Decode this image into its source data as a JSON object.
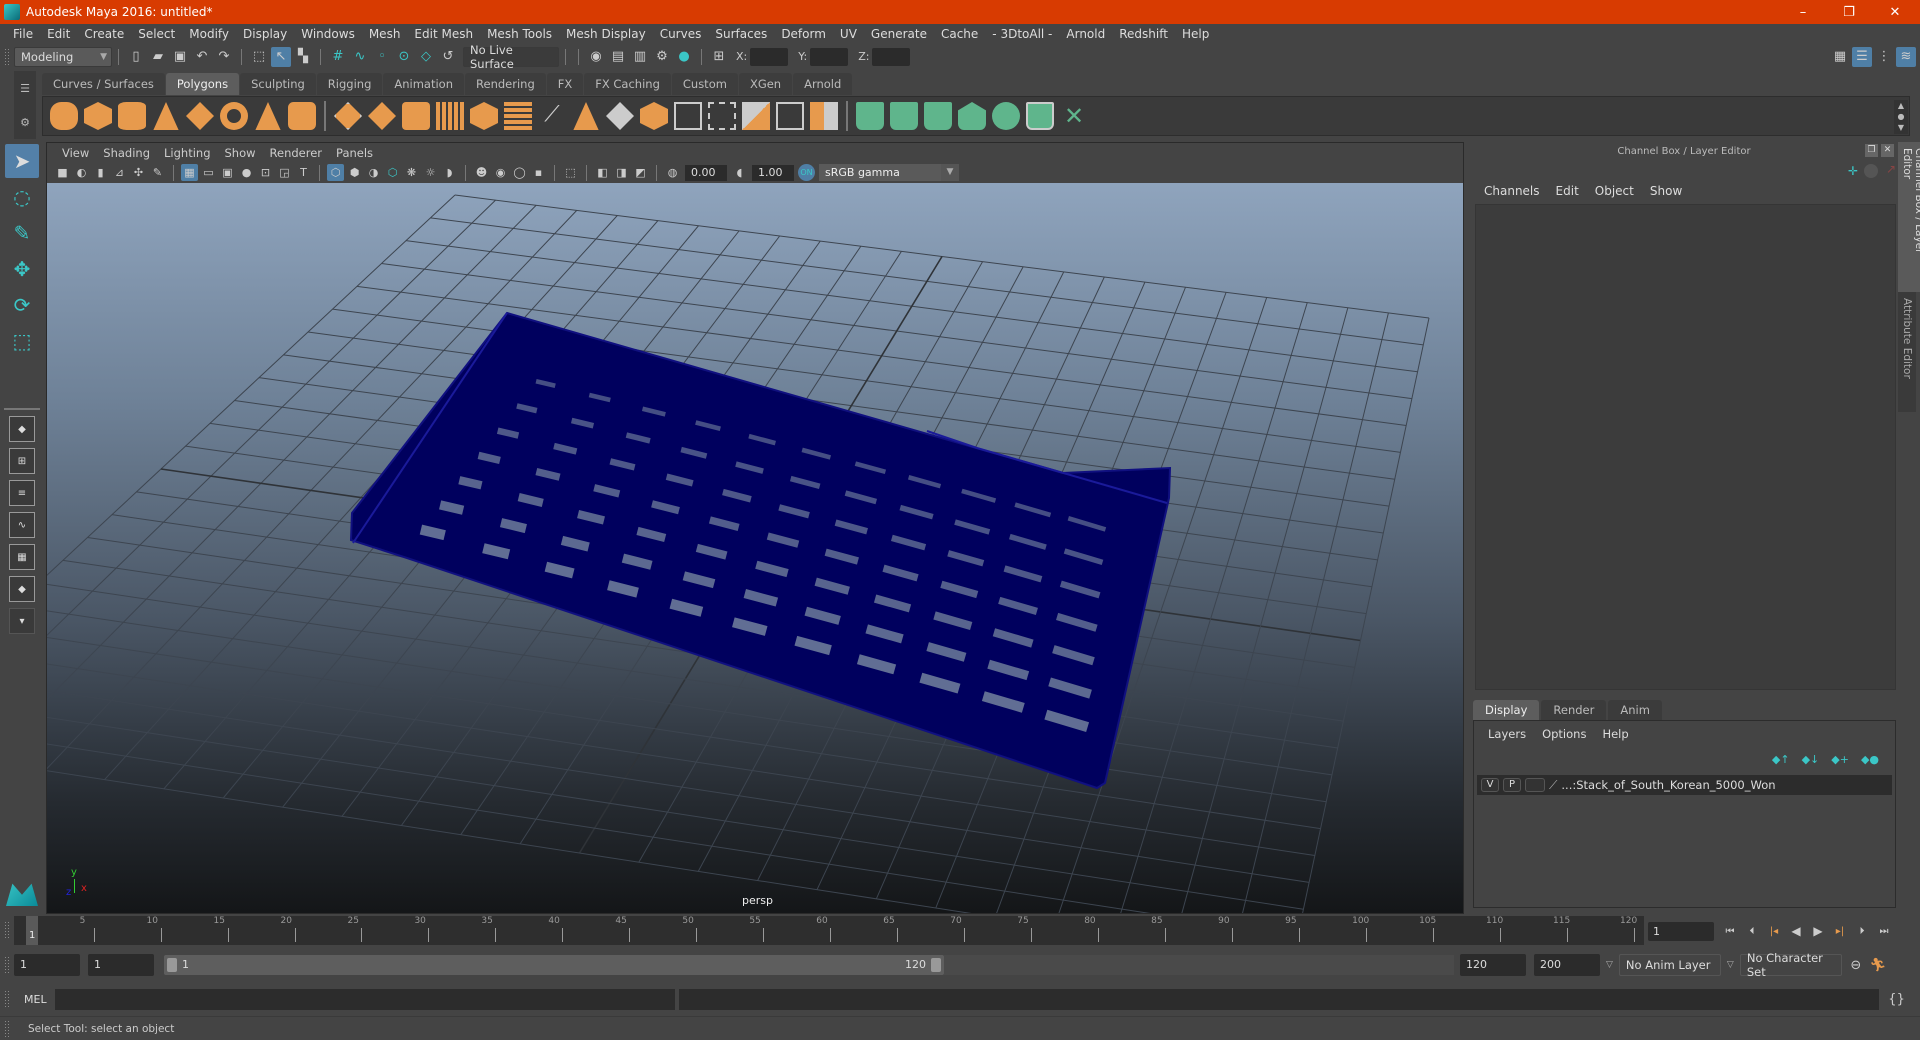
{
  "window": {
    "title": "Autodesk Maya 2016: untitled*",
    "controls": {
      "minimize": "–",
      "restore": "❐",
      "close": "✕"
    }
  },
  "menubar": [
    "File",
    "Edit",
    "Create",
    "Select",
    "Modify",
    "Display",
    "Windows",
    "Mesh",
    "Edit Mesh",
    "Mesh Tools",
    "Mesh Display",
    "Curves",
    "Surfaces",
    "Deform",
    "UV",
    "Generate",
    "Cache",
    "- 3DtoAll -",
    "Arnold",
    "Redshift",
    "Help"
  ],
  "statusline": {
    "menuset": "Modeling",
    "live_surface": "No Live Surface",
    "x_label": "X:",
    "y_label": "Y:",
    "z_label": "Z:"
  },
  "shelf": {
    "tabs": [
      "Curves / Surfaces",
      "Polygons",
      "Sculpting",
      "Rigging",
      "Animation",
      "Rendering",
      "FX",
      "FX Caching",
      "Custom",
      "XGen",
      "Arnold"
    ],
    "active_tab": "Polygons"
  },
  "viewport": {
    "menu": [
      "View",
      "Shading",
      "Lighting",
      "Show",
      "Renderer",
      "Panels"
    ],
    "exposure": "0.00",
    "gamma": "1.00",
    "color_space": "sRGB gamma",
    "camera_label": "persp",
    "axis": {
      "x": "x",
      "y": "y",
      "z": "z"
    },
    "model_color": "#00005e",
    "background_top": "#8fa4bd",
    "background_bottom": "#141618"
  },
  "right_panel": {
    "title": "Channel Box / Layer Editor",
    "menu": [
      "Channels",
      "Edit",
      "Object",
      "Show"
    ],
    "layer_tabs": [
      "Display",
      "Render",
      "Anim"
    ],
    "active_layer_tab": "Display",
    "layer_menu": [
      "Layers",
      "Options",
      "Help"
    ],
    "layers": [
      {
        "visible": "V",
        "playback": "P",
        "name": "...:Stack_of_South_Korean_5000_Won"
      }
    ],
    "vertical_tabs": [
      "Channel Box / Layer Editor",
      "Attribute Editor"
    ]
  },
  "timeline": {
    "ticks": [
      "5",
      "10",
      "15",
      "20",
      "25",
      "30",
      "35",
      "40",
      "45",
      "50",
      "55",
      "60",
      "65",
      "70",
      "75",
      "80",
      "85",
      "90",
      "95",
      "100",
      "105",
      "110",
      "115",
      "120"
    ],
    "current_marker": "1",
    "current_frame": "1"
  },
  "range": {
    "start_time": "1",
    "playback_start": "1",
    "slider_start": "1",
    "slider_end": "120",
    "playback_end": "120",
    "end_time": "200",
    "anim_layer": "No Anim Layer",
    "character_set": "No Character Set"
  },
  "command_line": {
    "label": "MEL",
    "value": ""
  },
  "help_line": "Select Tool: select an object"
}
